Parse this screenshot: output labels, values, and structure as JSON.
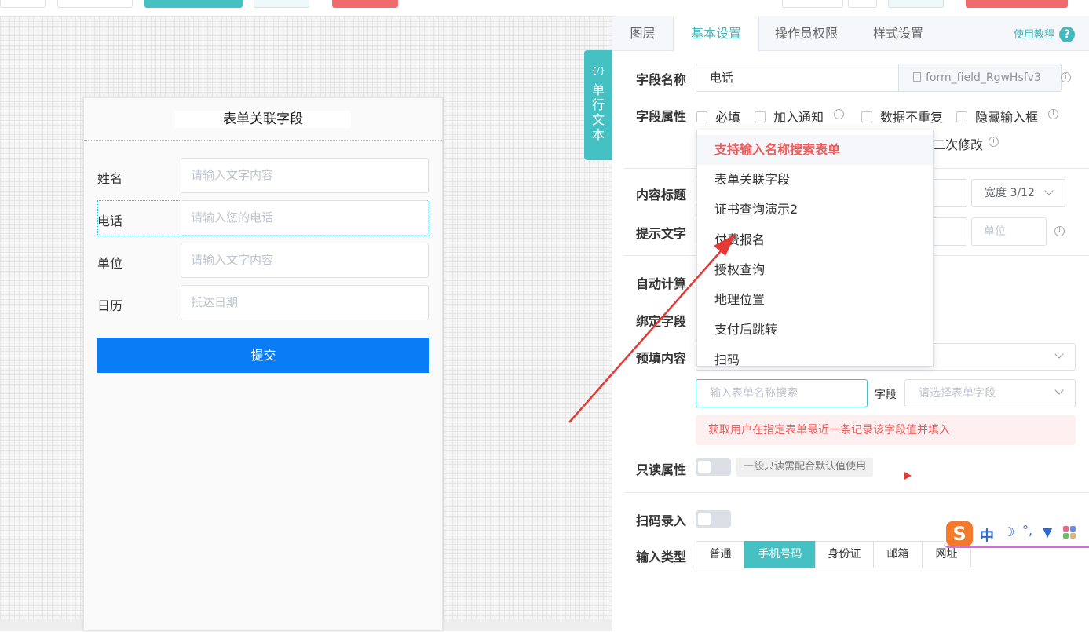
{
  "form_preview": {
    "title": "表单关联字段",
    "fields": [
      {
        "label": "姓名",
        "placeholder": "请输入文字内容"
      },
      {
        "label": "电话",
        "placeholder": "请输入您的电话"
      },
      {
        "label": "单位",
        "placeholder": "请输入文字内容"
      },
      {
        "label": "日历",
        "placeholder": "抵达日期"
      }
    ],
    "submit_label": "提交"
  },
  "side_tag": {
    "code": "{/}",
    "label": "单行文本"
  },
  "tabs": [
    "图层",
    "基本设置",
    "操作员权限",
    "样式设置"
  ],
  "active_tab": "基本设置",
  "help_label": "使用教程",
  "settings": {
    "field_name_label": "字段名称",
    "field_name_value": "电话",
    "field_id": "form_field_RgwHsfv3",
    "field_attr_label": "字段属性",
    "attr_required": "必填",
    "attr_notify": "加入通知",
    "attr_unique": "数据不重复",
    "attr_hide_input": "隐藏输入框",
    "attr_second_edit": "二次修改",
    "content_title_label": "内容标题",
    "width_select": "宽度 3/12",
    "hint_text_label": "提示文字",
    "unit_placeholder": "单位",
    "auto_calc_label": "自动计算",
    "bind_field_label": "绑定字段",
    "prefill_label": "预填内容",
    "form_search_placeholder": "输入表单名称搜索",
    "field_label": "字段",
    "field_select_placeholder": "请选择表单字段",
    "prefill_tip": "获取用户在指定表单最近一条记录该字段值并填入",
    "readonly_label": "只读属性",
    "readonly_tip": "一般只读需配合默认值使用",
    "scan_label": "扫码录入",
    "input_type_label": "输入类型",
    "input_types": [
      "普通",
      "手机号码",
      "身份证",
      "邮箱",
      "网址"
    ],
    "input_type_selected": "手机号码"
  },
  "dropdown": {
    "items": [
      "支持输入名称搜索表单",
      "表单关联字段",
      "证书查询演示2",
      "付费报名",
      "授权查询",
      "地理位置",
      "支付后跳转",
      "扫码"
    ],
    "highlighted": "支持输入名称搜索表单"
  },
  "ime_toolbar": {
    "chars": [
      "中"
    ]
  },
  "colors": {
    "accent": "#45c0c3",
    "submit": "#0a7cf6",
    "danger": "#ef5a5a",
    "annotation_arrow": "#e53935"
  }
}
